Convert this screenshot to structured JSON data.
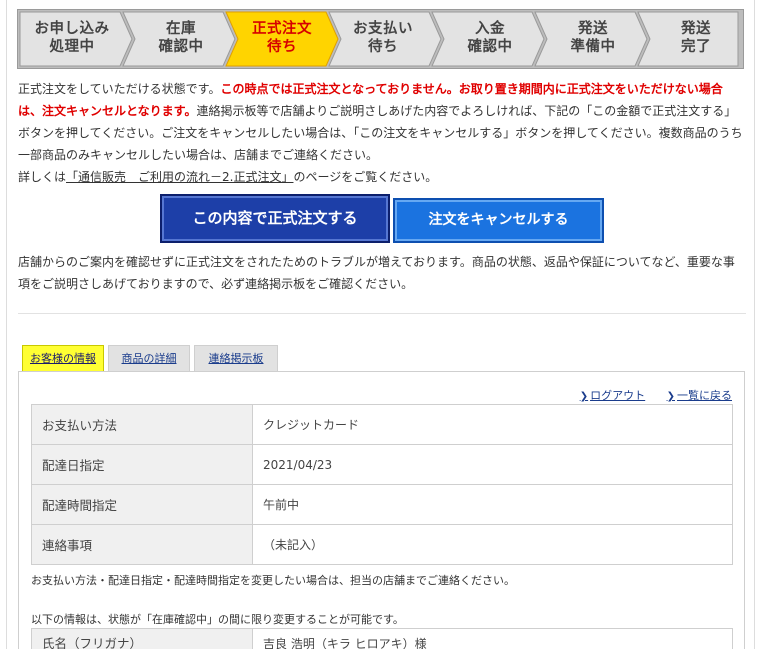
{
  "steps": [
    {
      "label": "お申し込み\n処理中",
      "active": false
    },
    {
      "label": "在庫\n確認中",
      "active": false
    },
    {
      "label": "正式注文\n待ち",
      "active": true
    },
    {
      "label": "お支払い\n待ち",
      "active": false
    },
    {
      "label": "入金\n確認中",
      "active": false
    },
    {
      "label": "発送\n準備中",
      "active": false
    },
    {
      "label": "発送\n完了",
      "active": false
    }
  ],
  "intro": {
    "p1": "正式注文をしていただける状態です。",
    "p1_red": "この時点では正式注文となっておりません。お取り置き期間内に正式注文をいただけない場合は、注文キャンセルとなります。",
    "p1_rest": "連絡掲示板等で店舗よりご説明さしあげた内容でよろしければ、下記の「この金額で正式注文する」ボタンを押してください。ご注文をキャンセルしたい場合は、「この注文をキャンセルする」ボタンを押してください。複数商品のうち一部商品のみキャンセルしたい場合は、店舗までご連絡ください。",
    "p2_pre": "詳しくは",
    "p2_link": "「通信販売　ご利用の流れ－2.正式注文」",
    "p2_post": "のページをご覧ください。"
  },
  "buttons": {
    "confirm": "この内容で正式注文する",
    "cancel": "注文をキャンセルする"
  },
  "notice": "店舗からのご案内を確認せずに正式注文をされたためのトラブルが増えております。商品の状態、返品や保証についてなど、重要な事項をご説明さしあげておりますので、必ず連絡掲示板をご確認ください。",
  "tabs": [
    "お客様の情報",
    "商品の詳細",
    "連絡掲示板"
  ],
  "toplinks": {
    "logout": "ログアウト",
    "back": "一覧に戻る"
  },
  "info_rows": [
    {
      "key": "お支払い方法",
      "value": "クレジットカード"
    },
    {
      "key": "配達日指定",
      "value": "2021/04/23"
    },
    {
      "key": "配達時間指定",
      "value": "午前中"
    },
    {
      "key": "連絡事項",
      "value": "（未記入）"
    }
  ],
  "note1": "お支払い方法・配達日指定・配達時間指定を変更したい場合は、担当の店舗までご連絡ください。",
  "note2": "以下の情報は、状態が「在庫確認中」の間に限り変更することが可能です。",
  "name_row": {
    "key": "氏名（フリガナ）",
    "value": "吉良 浩明（キラ ヒロアキ）様"
  },
  "colors": {
    "active_step": "#ffd400",
    "inactive_step": "#e3e3e3",
    "red": "#e00000",
    "confirm_btn": "#1d3fa8",
    "cancel_btn": "#1b73e0",
    "tab_active": "#ffff33"
  }
}
